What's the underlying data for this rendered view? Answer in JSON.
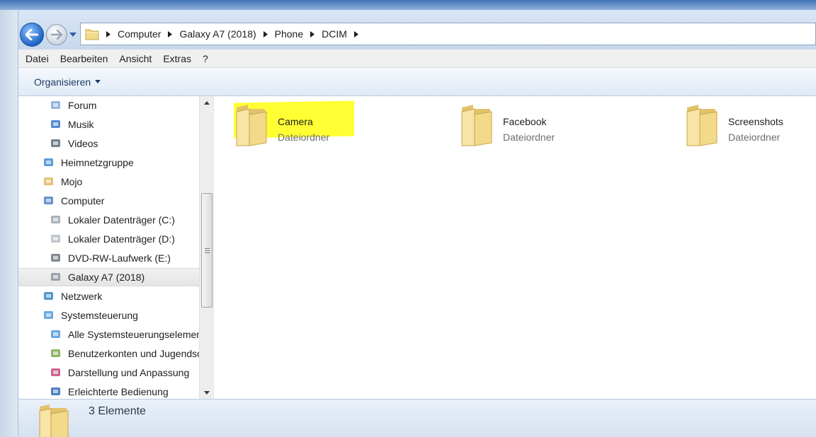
{
  "address_bar": {
    "crumbs": [
      "Computer",
      "Galaxy A7 (2018)",
      "Phone",
      "DCIM"
    ]
  },
  "menu": [
    "Datei",
    "Bearbeiten",
    "Ansicht",
    "Extras",
    "?"
  ],
  "command_bar": {
    "organize_label": "Organisieren"
  },
  "nav_tree": [
    {
      "label": "Forum",
      "icon": "forum-icon",
      "indent": 1
    },
    {
      "label": "Musik",
      "icon": "music-icon",
      "indent": 1
    },
    {
      "label": "Videos",
      "icon": "videos-icon",
      "indent": 1
    },
    {
      "label": "Heimnetzgruppe",
      "icon": "homegroup-icon",
      "indent": 0
    },
    {
      "label": "Mojo",
      "icon": "user-folder-icon",
      "indent": 0
    },
    {
      "label": "Computer",
      "icon": "computer-icon",
      "indent": 0
    },
    {
      "label": "Lokaler Datenträger (C:)",
      "icon": "drive-c-icon",
      "indent": 1
    },
    {
      "label": "Lokaler Datenträger (D:)",
      "icon": "drive-d-icon",
      "indent": 1
    },
    {
      "label": "DVD-RW-Laufwerk (E:)",
      "icon": "dvd-drive-icon",
      "indent": 1
    },
    {
      "label": "Galaxy A7 (2018)",
      "icon": "phone-icon",
      "indent": 1,
      "selected": true
    },
    {
      "label": "Netzwerk",
      "icon": "network-icon",
      "indent": 0
    },
    {
      "label": "Systemsteuerung",
      "icon": "control-panel-icon",
      "indent": 0
    },
    {
      "label": "Alle Systemsteuerungselemente",
      "icon": "control-panel-items-icon",
      "indent": 1
    },
    {
      "label": "Benutzerkonten und Jugendschutz",
      "icon": "user-accounts-icon",
      "indent": 1
    },
    {
      "label": "Darstellung und Anpassung",
      "icon": "appearance-icon",
      "indent": 1
    },
    {
      "label": "Erleichterte Bedienung",
      "icon": "ease-of-access-icon",
      "indent": 1
    }
  ],
  "folders": [
    {
      "name": "Camera",
      "kind": "Dateiordner",
      "highlighted": true
    },
    {
      "name": "Facebook",
      "kind": "Dateiordner"
    },
    {
      "name": "Screenshots",
      "kind": "Dateiordner"
    }
  ],
  "status": {
    "item_count": "3 Elemente"
  },
  "colors": {
    "highlight": "#ffff33",
    "folder": "#f3d98a",
    "accent": "#1d63c4"
  }
}
